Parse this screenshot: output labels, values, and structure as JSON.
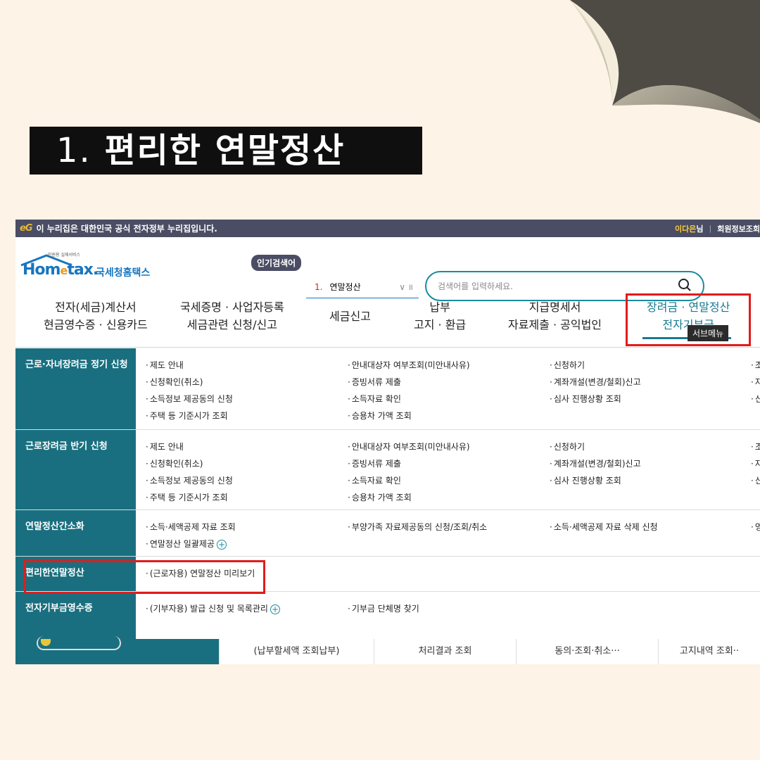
{
  "heading": {
    "number": "1.",
    "text": "편리한 연말정산"
  },
  "topbar": {
    "logo": "eG",
    "notice": "이 누리집은 대한민국 공식 전자정부 누리집입니다.",
    "user": "이다은",
    "user_suffix": "님",
    "member_link": "회원정보조회"
  },
  "logo": {
    "small": "민원용 실제서비스",
    "home": "Hom",
    "e": "e",
    "tax": "tax.",
    "name": "국세청홈택스"
  },
  "popular": {
    "badge": "인기검색어",
    "rank": "1.",
    "term": "연말정산",
    "control": "∨ ॥"
  },
  "search": {
    "placeholder": "검색어를 입력하세요."
  },
  "gnb": [
    {
      "line1": "전자(세금)계산서",
      "line2": "현금영수증 · 신용카드"
    },
    {
      "line1": "국세증명 · 사업자등록",
      "line2": "세금관련 신청/신고"
    },
    {
      "line1": "세금신고",
      "line2": ""
    },
    {
      "line1": "납부",
      "line2": "고지 · 환급"
    },
    {
      "line1": "지급명세서",
      "line2": "자료제출 · 공익법인"
    },
    {
      "line1": "장려금 · 연말정산",
      "line2": "전자기부금"
    }
  ],
  "tooltip": "서브메뉴",
  "submenu": [
    {
      "category": "근로·자녀장려금 정기 신청",
      "col1": [
        "제도 안내",
        "신청확인(취소)",
        "소득정보 제공동의 신청",
        "주택 등 기준시가 조회"
      ],
      "col2": [
        "안내대상자 여부조회(미안내사유)",
        "증빙서류 제출",
        "소득자료 확인",
        "승용차 가액 조회"
      ],
      "col3": [
        "신청하기",
        "계좌개설(변경/철회)신고",
        "심사 진행상황 조회"
      ],
      "col4": [
        "조",
        "자",
        "신"
      ]
    },
    {
      "category": "근로장려금 반기 신청",
      "col1": [
        "제도 안내",
        "신청확인(취소)",
        "소득정보 제공동의 신청",
        "주택 등 기준시가 조회"
      ],
      "col2": [
        "안내대상자 여부조회(미안내사유)",
        "증빙서류 제출",
        "소득자료 확인",
        "승용차 가액 조회"
      ],
      "col3": [
        "신청하기",
        "계좌개설(변경/철회)신고",
        "심사 진행상황 조회"
      ],
      "col4": [
        "조",
        "자",
        "신"
      ]
    },
    {
      "category": "연말정산간소화",
      "col1": [
        "소득·세액공제 자료 조회",
        "연말정산 일괄제공"
      ],
      "col2": [
        "부양가족 자료제공동의 신청/조회/취소"
      ],
      "col3": [
        "소득·세액공제 자료 삭제 신청"
      ],
      "col4": [
        "영"
      ]
    },
    {
      "category": "편리한연말정산",
      "col1": [
        "(근로자용) 연말정산 미리보기"
      ],
      "col2": [],
      "col3": [],
      "col4": []
    },
    {
      "category": "전자기부금영수증",
      "col1": [
        "(기부자용) 발급 신청 및 목록관리"
      ],
      "col2": [
        "기부금 단체명 찾기"
      ],
      "col3": [],
      "col4": []
    }
  ],
  "bottom": [
    "(납부할세액 조회납부)",
    "처리결과 조회",
    "동의·조회·취소···",
    "고지내역 조회··"
  ]
}
